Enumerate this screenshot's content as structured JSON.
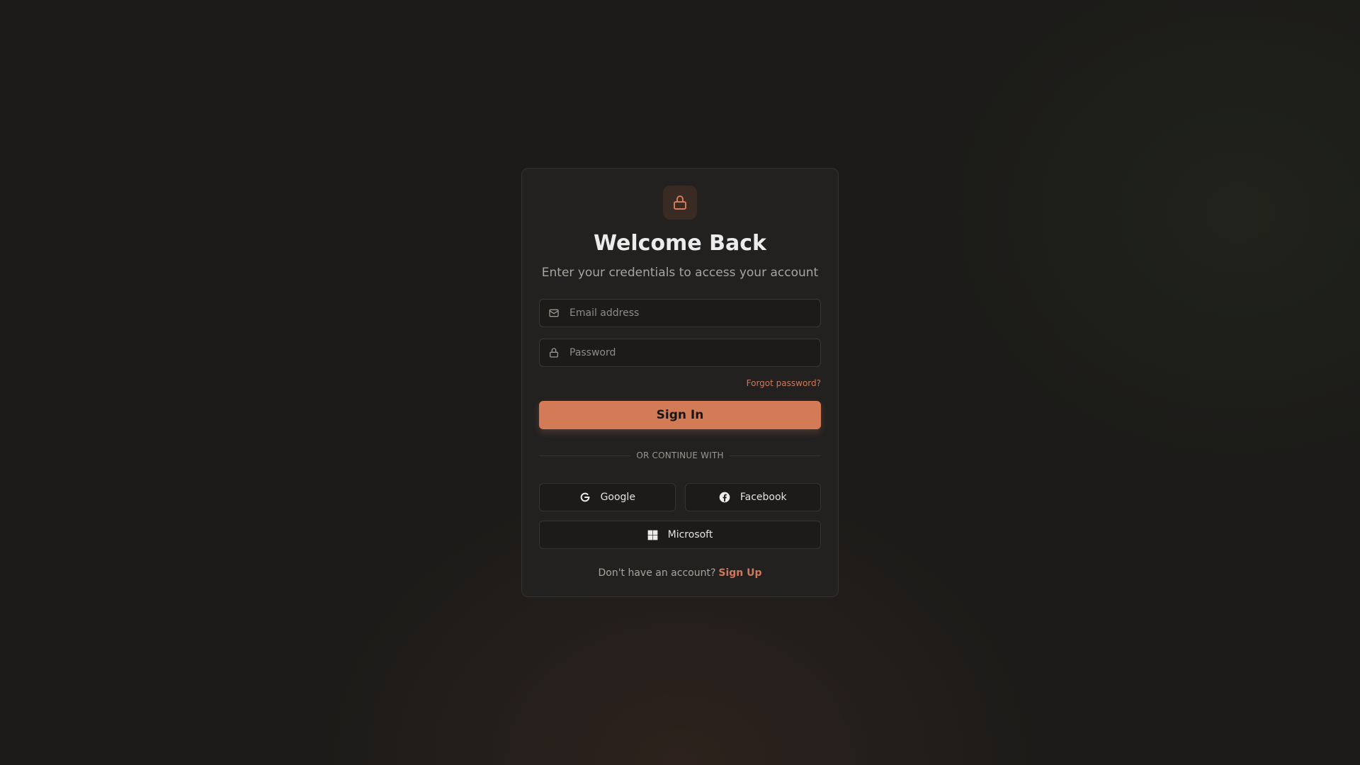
{
  "theme": {
    "accent": "#d37a57",
    "background": "#1c1b19",
    "card": "#222120"
  },
  "header": {
    "icon": "lock-icon",
    "title": "Welcome Back",
    "subtitle": "Enter your credentials to access your account"
  },
  "form": {
    "email": {
      "icon": "mail-icon",
      "placeholder": "Email address",
      "value": ""
    },
    "password": {
      "icon": "lock-icon",
      "placeholder": "Password",
      "value": ""
    },
    "forgot_label": "Forgot password?",
    "submit_label": "Sign In"
  },
  "divider": {
    "label": "OR CONTINUE WITH"
  },
  "social": {
    "google": {
      "icon": "google-icon",
      "label": "Google"
    },
    "facebook": {
      "icon": "facebook-icon",
      "label": "Facebook"
    },
    "microsoft": {
      "icon": "microsoft-icon",
      "label": "Microsoft"
    }
  },
  "footer": {
    "prompt": "Don't have an account?",
    "link_label": "Sign Up"
  }
}
